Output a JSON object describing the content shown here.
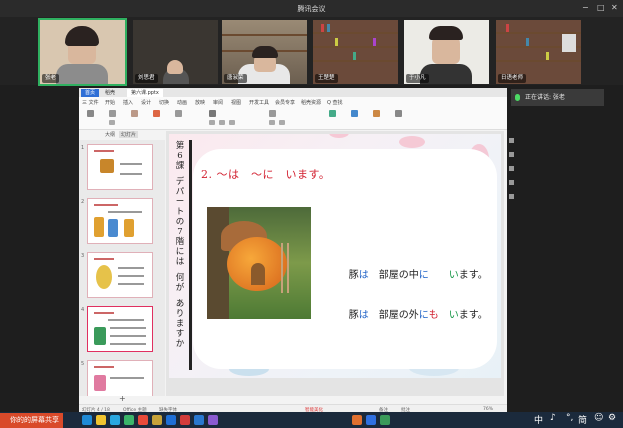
{
  "window": {
    "title": "腾讯会议",
    "controls": [
      "−",
      "□",
      "✕"
    ]
  },
  "participants": [
    {
      "name": "张老",
      "active": true,
      "bg": "#d9c7b0"
    },
    {
      "name": "刘思君",
      "active": false,
      "bg": "#3a3631"
    },
    {
      "name": "唐淑荣",
      "active": false,
      "bg": "#8a7d6b"
    },
    {
      "name": "王楚楚",
      "active": false,
      "bg": "#6b4a3a"
    },
    {
      "name": "于小凡",
      "active": false,
      "bg": "#e8e8e4"
    },
    {
      "name": "日语老师",
      "active": false,
      "bg": "#6b4a3a"
    }
  ],
  "toast": {
    "text": "正在讲话: 张老"
  },
  "wps": {
    "tabs": [
      "首页",
      "稻壳",
      "第六课.pptx"
    ],
    "menu": [
      "三 文件",
      "开始",
      "插入",
      "设计",
      "切换",
      "动画",
      "放映",
      "审阅",
      "视图",
      "开发工具",
      "会员专享",
      "稻壳资源",
      "Q 查找"
    ],
    "panel_tabs": [
      "大纲",
      "幻灯片"
    ],
    "thumb_numbers": [
      "1",
      "2",
      "3",
      "4",
      "5"
    ],
    "add_label": "+",
    "status": {
      "left": "幻灯片 4 / 18",
      "theme": "Office 主题",
      "font_missing": "缺失字体",
      "beautify": "智能美化",
      "notes": "备注",
      "comment": "批注",
      "zoom": "76%"
    }
  },
  "slide": {
    "vertical_title": [
      "第",
      "6",
      "課",
      "",
      "デ",
      "パ",
      "ー",
      "ト",
      "の",
      "7",
      "階",
      "に",
      "は",
      "",
      "何",
      "が",
      "",
      "あ",
      "り",
      "ま",
      "す",
      "か"
    ],
    "heading": "2. ～は　～に　います。",
    "sentence1": [
      {
        "text": "豚",
        "color": "black"
      },
      {
        "text": "は",
        "color": "blue"
      },
      {
        "text": "　部屋の中",
        "color": "black"
      },
      {
        "text": "に",
        "color": "blue"
      },
      {
        "text": "　　います。",
        "color": "green_tail"
      }
    ],
    "sentence2": [
      {
        "text": "豚",
        "color": "black"
      },
      {
        "text": "は",
        "color": "blue"
      },
      {
        "text": "　部屋の外",
        "color": "black"
      },
      {
        "text": "に",
        "color": "blue"
      },
      {
        "text": "も",
        "color": "red"
      },
      {
        "text": "　います。",
        "color": "green_tail"
      }
    ],
    "colors": {
      "heading": "#d21e2e",
      "particle": "#2264c8",
      "mo": "#d21e2e",
      "imasu_i": "#1a9a4a"
    }
  },
  "taskbar": {
    "share_label": "你的的屏幕共享",
    "ime": [
      "中",
      "♪",
      "°,",
      "简",
      "☺",
      "⚙"
    ]
  }
}
